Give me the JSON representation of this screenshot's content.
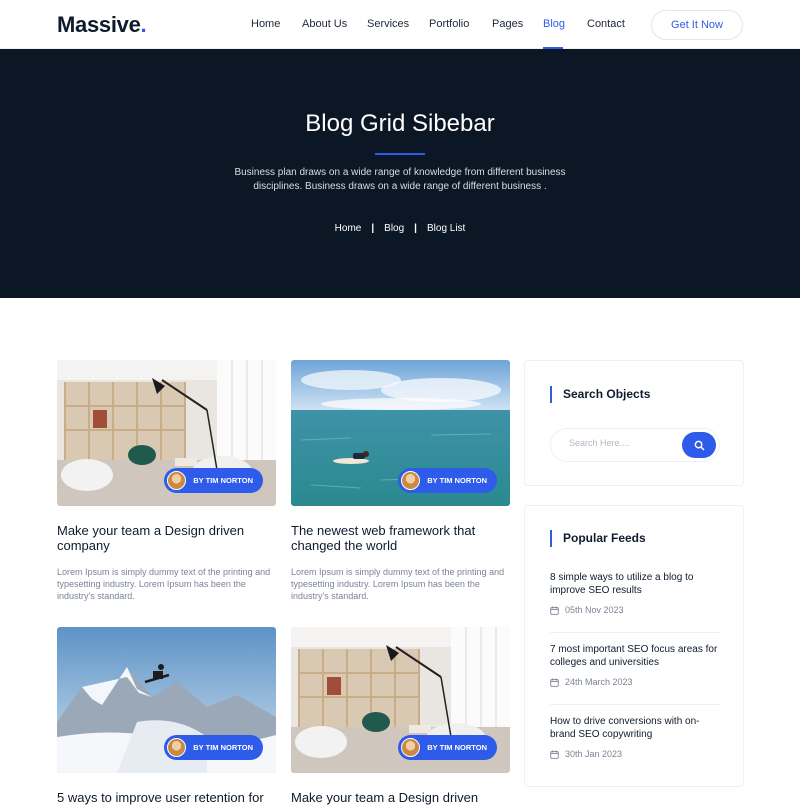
{
  "header": {
    "logo": "Massive",
    "logo_dot": ".",
    "nav": [
      "Home",
      "About Us",
      "Services",
      "Portfolio",
      "Pages",
      "Blog",
      "Contact"
    ],
    "active_nav": "Blog",
    "cta_label": "Get It Now"
  },
  "hero": {
    "title": "Blog Grid Sibebar",
    "description": "Business plan draws on a wide range of knowledge from different business disciplines. Business draws on a wide range of different business .",
    "breadcrumb": [
      "Home",
      "Blog",
      "Blog List"
    ],
    "separator": "|"
  },
  "posts": [
    {
      "author": "BY TIM NORTON",
      "title": "Make your team a Design driven company",
      "excerpt": "Lorem Ipsum is simply dummy text of the printing and typesetting industry. Lorem Ipsum has been the industry's standard.",
      "image": "office-interior"
    },
    {
      "author": "BY TIM NORTON",
      "title": "The newest web framework that changed the world",
      "excerpt": "Lorem Ipsum is simply dummy text of the printing and typesetting industry. Lorem Ipsum has been the industry's standard.",
      "image": "surfer-ocean"
    },
    {
      "author": "BY TIM NORTON",
      "title": "5 ways to improve user retention for",
      "excerpt": "",
      "image": "snowboard-mountain"
    },
    {
      "author": "BY TIM NORTON",
      "title": "Make your team a Design driven",
      "excerpt": "",
      "image": "office-interior"
    }
  ],
  "sidebar": {
    "search": {
      "title": "Search Objects",
      "placeholder": "Search Here....",
      "button_icon": "search-icon"
    },
    "popular": {
      "title": "Popular Feeds",
      "items": [
        {
          "title": "8 simple ways to utilize a blog to improve SEO results",
          "date": "05th Nov 2023"
        },
        {
          "title": "7 most important SEO focus areas for colleges and universities",
          "date": "24th March 2023"
        },
        {
          "title": "How to drive conversions with on-brand SEO copywriting",
          "date": "30th Jan 2023"
        }
      ]
    }
  },
  "colors": {
    "accent": "#2f5bea",
    "hero_bg": "#0c1726",
    "text_dark": "#0e1b2c",
    "text_muted": "#7a8493"
  }
}
